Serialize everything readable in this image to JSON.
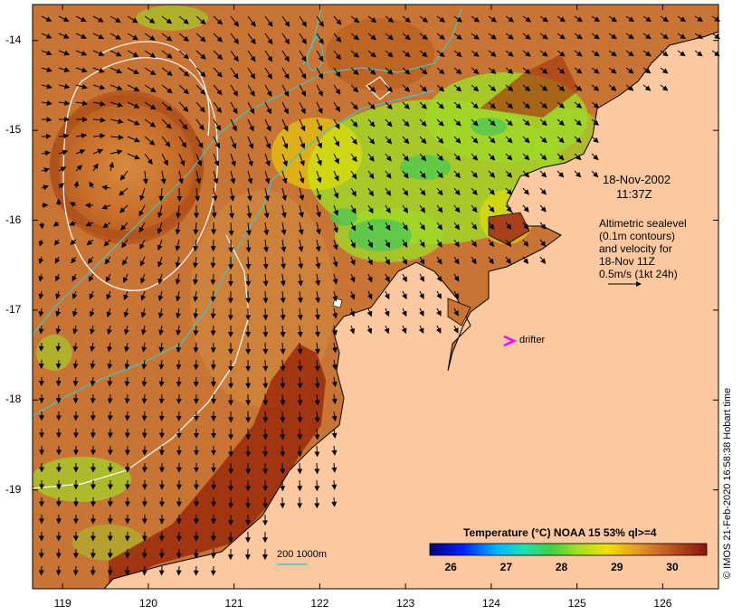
{
  "map": {
    "y_ticks": [
      "-14",
      "-15",
      "-16",
      "-17",
      "-18",
      "-19"
    ],
    "x_ticks": [
      "119",
      "120",
      "121",
      "122",
      "123",
      "124",
      "125",
      "126"
    ],
    "lon_range": [
      118.65,
      126.65
    ],
    "lat_range": [
      -13.6,
      -20.1
    ]
  },
  "annotations": {
    "date": "18-Nov-2002",
    "time": "11:37Z",
    "sealevel_1": "Altimetric sealevel",
    "sealevel_2": "(0.1m contours)",
    "sealevel_3": "and velocity for",
    "sealevel_4": "18-Nov 11Z",
    "sealevel_5": "0.5m/s (1kt 24h)",
    "drifter": "drifter",
    "bathy_legend": "200  1000m"
  },
  "colorbar": {
    "title": "Temperature (°C) NOAA 15 53% ql>=4",
    "ticks": [
      "26",
      "27",
      "28",
      "29",
      "30"
    ],
    "range": [
      25.6,
      30.6
    ]
  },
  "credit": "© IMOS 21-Feb-2020 16:58:38 Hobart time",
  "colors": {
    "land": "#fcc8a0",
    "sst_warm": "#c86428",
    "sst_hot": "#961e0a",
    "sst_cool": "#a0dc28",
    "bathymetry": "#40c8c8",
    "contour": "#ffffff",
    "drifter": "#ff00ff"
  }
}
